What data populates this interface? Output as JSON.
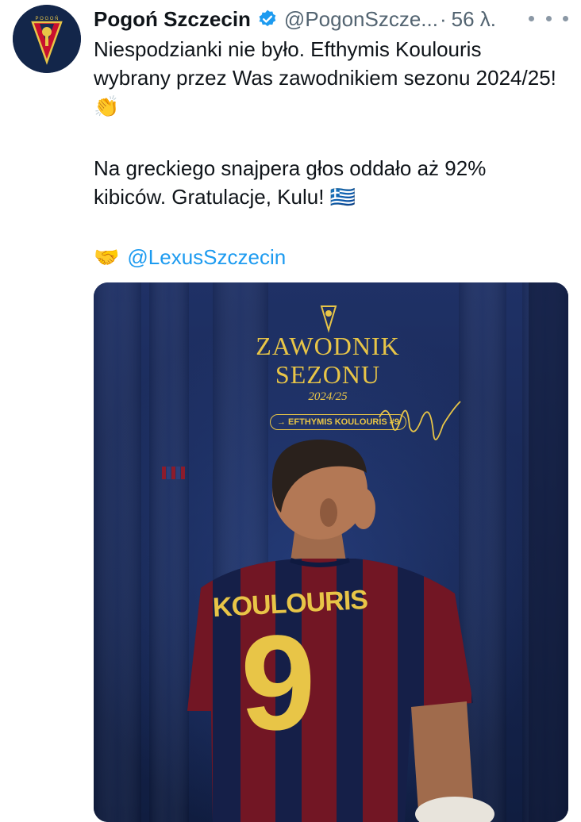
{
  "tweet": {
    "display_name": "Pogoń Szczecin",
    "handle": "@PogonSzcze...",
    "separator": "·",
    "time": "56 λ.",
    "paragraph1": "Niespodzianki nie było. Efthymis Koulouris wybrany przez Was zawodnikiem sezonu 2024/25! 👏",
    "paragraph2": "Na greckiego snajpera głos oddało aż 92% kibiców. Gratulacje, Kulu! 🇬🇷",
    "mention": "@LexusSzczecin",
    "mention_emoji": "🤝",
    "verified_icon": "verified-badge-icon",
    "more_icon": "more-options-icon"
  },
  "media": {
    "title_line1": "ZAWODNIK",
    "title_line2": "SEZONU",
    "season": "2024/25",
    "player_tag": "→ EFTHYMIS KOULOURIS #9",
    "jersey_name": "KOULOURIS",
    "jersey_number": "9",
    "colors": {
      "background": "#1a2a55",
      "gold": "#e8c547",
      "red": "#8c1c2c",
      "navy": "#13264a"
    }
  }
}
